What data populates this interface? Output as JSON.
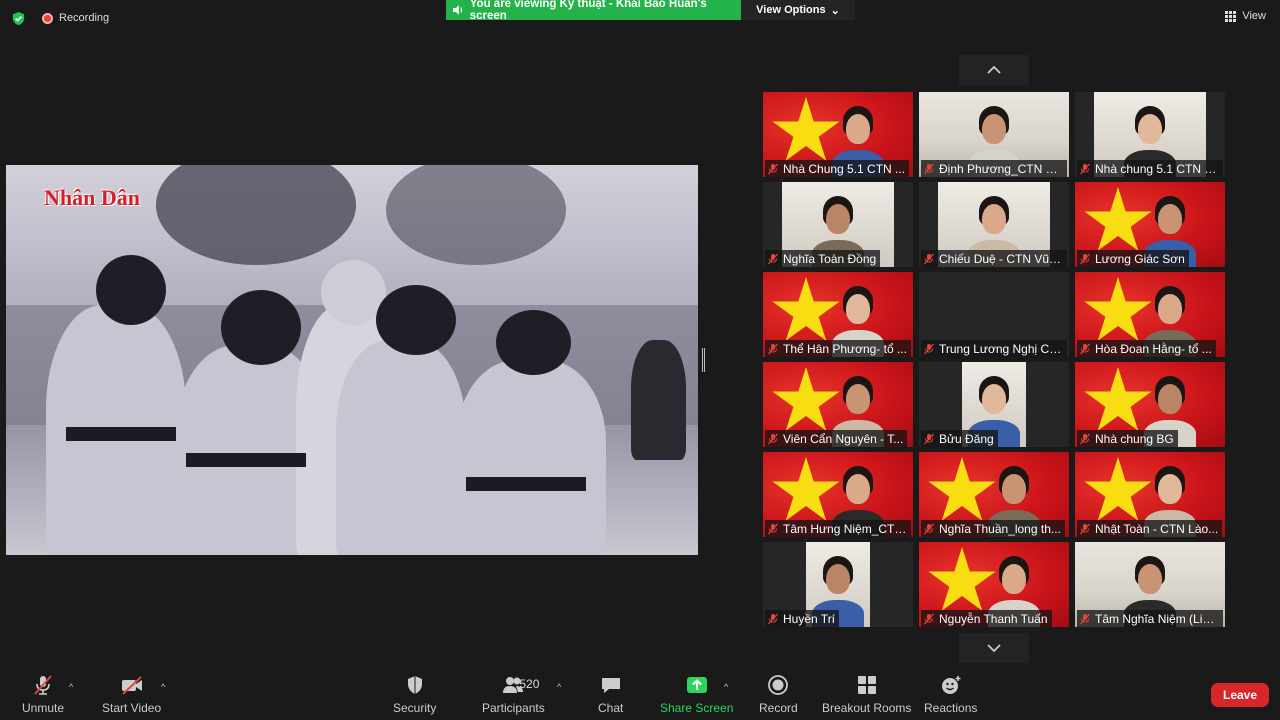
{
  "top_bar": {
    "recording_label": "Recording",
    "viewing_banner": "You are viewing Kỹ thuật - Khải Bảo Huấn's screen",
    "view_options_label": "View Options",
    "view_label": "View"
  },
  "shared_screen": {
    "watermark": "Nhân Dân"
  },
  "participants_gallery": [
    {
      "name": "Nhà Chung 5.1 CTN ...",
      "bg": "flag"
    },
    {
      "name": "Định Phương_CTN H...",
      "bg": "room"
    },
    {
      "name": "Nhà chung 5.1 CTN H...",
      "bg": "black"
    },
    {
      "name": "Nghĩa Toàn Đồng",
      "bg": "black"
    },
    {
      "name": "Chiếu Duệ - CTN Vũn...",
      "bg": "black"
    },
    {
      "name": "Lương Giác Sơn",
      "bg": "flag"
    },
    {
      "name": "Thể Hân Phương- tổ ...",
      "bg": "flag"
    },
    {
      "name": "Trung Lương Nghị CT...",
      "bg": "black"
    },
    {
      "name": "Hòa Đoan Hằng- tổ ...",
      "bg": "flag"
    },
    {
      "name": "Viên Cẩn Nguyên - T...",
      "bg": "flag"
    },
    {
      "name": "Bửu Đăng",
      "bg": "black"
    },
    {
      "name": "Nhà chung BG",
      "bg": "flag"
    },
    {
      "name": "Tâm Hưng Niệm_CTN...",
      "bg": "flag"
    },
    {
      "name": "Nghĩa Thuần_long th...",
      "bg": "flag"
    },
    {
      "name": "Nhật Toàn - CTN Lào...",
      "bg": "flag"
    },
    {
      "name": "Huyền Trí",
      "bg": "black"
    },
    {
      "name": "Nguyễn Thanh Tuấn",
      "bg": "flag"
    },
    {
      "name": "Tâm Nghĩa Niệm (Liê...",
      "bg": "room"
    }
  ],
  "toolbar": {
    "unmute": "Unmute",
    "start_video": "Start Video",
    "security": "Security",
    "participants": "Participants",
    "participant_count": "520",
    "chat": "Chat",
    "share_screen": "Share Screen",
    "record": "Record",
    "breakout_rooms": "Breakout Rooms",
    "reactions": "Reactions",
    "leave": "Leave"
  },
  "colors": {
    "share_banner": "#24b34a",
    "leave_button": "#d8262b",
    "background": "#1a1a1a"
  }
}
